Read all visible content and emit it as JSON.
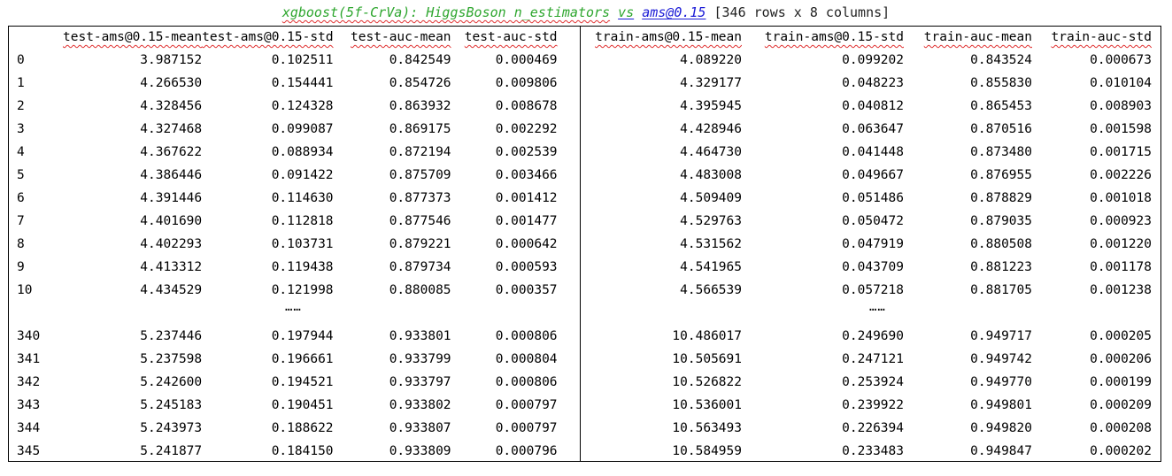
{
  "title": {
    "part1": "xgboost(5f-CrVa): HiggsBoson n_estimators",
    "vs": "vs",
    "link": "ams@0.15",
    "suffix": "[346 rows x 8 columns]"
  },
  "ellipsis": "……",
  "left": {
    "headers": [
      "test-ams@0.15-mean",
      "test-ams@0.15-std",
      "test-auc-mean",
      "test-auc-std"
    ],
    "rows": [
      [
        "0",
        "3.987152",
        "0.102511",
        "0.842549",
        "0.000469"
      ],
      [
        "1",
        "4.266530",
        "0.154441",
        "0.854726",
        "0.009806"
      ],
      [
        "2",
        "4.328456",
        "0.124328",
        "0.863932",
        "0.008678"
      ],
      [
        "3",
        "4.327468",
        "0.099087",
        "0.869175",
        "0.002292"
      ],
      [
        "4",
        "4.367622",
        "0.088934",
        "0.872194",
        "0.002539"
      ],
      [
        "5",
        "4.386446",
        "0.091422",
        "0.875709",
        "0.003466"
      ],
      [
        "6",
        "4.391446",
        "0.114630",
        "0.877373",
        "0.001412"
      ],
      [
        "7",
        "4.401690",
        "0.112818",
        "0.877546",
        "0.001477"
      ],
      [
        "8",
        "4.402293",
        "0.103731",
        "0.879221",
        "0.000642"
      ],
      [
        "9",
        "4.413312",
        "0.119438",
        "0.879734",
        "0.000593"
      ],
      [
        "10",
        "4.434529",
        "0.121998",
        "0.880085",
        "0.000357"
      ]
    ],
    "tail_rows": [
      [
        "340",
        "5.237446",
        "0.197944",
        "0.933801",
        "0.000806"
      ],
      [
        "341",
        "5.237598",
        "0.196661",
        "0.933799",
        "0.000804"
      ],
      [
        "342",
        "5.242600",
        "0.194521",
        "0.933797",
        "0.000806"
      ],
      [
        "343",
        "5.245183",
        "0.190451",
        "0.933802",
        "0.000797"
      ],
      [
        "344",
        "5.243973",
        "0.188622",
        "0.933807",
        "0.000797"
      ],
      [
        "345",
        "5.241877",
        "0.184150",
        "0.933809",
        "0.000796"
      ]
    ]
  },
  "right": {
    "headers": [
      "train-ams@0.15-mean",
      "train-ams@0.15-std",
      "train-auc-mean",
      "train-auc-std"
    ],
    "rows": [
      [
        "4.089220",
        "0.099202",
        "0.843524",
        "0.000673"
      ],
      [
        "4.329177",
        "0.048223",
        "0.855830",
        "0.010104"
      ],
      [
        "4.395945",
        "0.040812",
        "0.865453",
        "0.008903"
      ],
      [
        "4.428946",
        "0.063647",
        "0.870516",
        "0.001598"
      ],
      [
        "4.464730",
        "0.041448",
        "0.873480",
        "0.001715"
      ],
      [
        "4.483008",
        "0.049667",
        "0.876955",
        "0.002226"
      ],
      [
        "4.509409",
        "0.051486",
        "0.878829",
        "0.001018"
      ],
      [
        "4.529763",
        "0.050472",
        "0.879035",
        "0.000923"
      ],
      [
        "4.531562",
        "0.047919",
        "0.880508",
        "0.001220"
      ],
      [
        "4.541965",
        "0.043709",
        "0.881223",
        "0.001178"
      ],
      [
        "4.566539",
        "0.057218",
        "0.881705",
        "0.001238"
      ]
    ],
    "tail_rows": [
      [
        "10.486017",
        "0.249690",
        "0.949717",
        "0.000205"
      ],
      [
        "10.505691",
        "0.247121",
        "0.949742",
        "0.000206"
      ],
      [
        "10.526822",
        "0.253924",
        "0.949770",
        "0.000199"
      ],
      [
        "10.536001",
        "0.239922",
        "0.949801",
        "0.000209"
      ],
      [
        "10.563493",
        "0.226394",
        "0.949820",
        "0.000208"
      ],
      [
        "10.584959",
        "0.233483",
        "0.949847",
        "0.000202"
      ]
    ]
  },
  "colors": {
    "green": "#2ea62e",
    "link": "#1a1ad6",
    "squiggle": "#e03030"
  }
}
